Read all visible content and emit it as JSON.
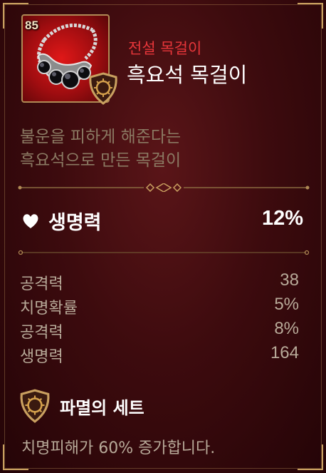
{
  "item": {
    "level": "85",
    "grade": "전설 목걸이",
    "name": "흑요석 목걸이",
    "icon": "obsidian-necklace-icon"
  },
  "flavor_text": {
    "line1": "불운을 피하게 해준다는",
    "line2": "흑요석으로 만든 목걸이"
  },
  "main_stat": {
    "icon": "heart-icon",
    "label": "생명력",
    "value": "12%"
  },
  "sub_stats": [
    {
      "label": "공격력",
      "value": "38"
    },
    {
      "label": "치명확률",
      "value": "5%"
    },
    {
      "label": "공격력",
      "value": "8%"
    },
    {
      "label": "생명력",
      "value": "164"
    }
  ],
  "set_bonus": {
    "icon": "destruction-set-emblem-icon",
    "name": "파멸의 세트",
    "description": "치명피해가 60% 증가합니다."
  },
  "colors": {
    "grade_legendary": "#e8363a",
    "gold_trim": "#c9a060",
    "background": "#3d0b0e"
  }
}
